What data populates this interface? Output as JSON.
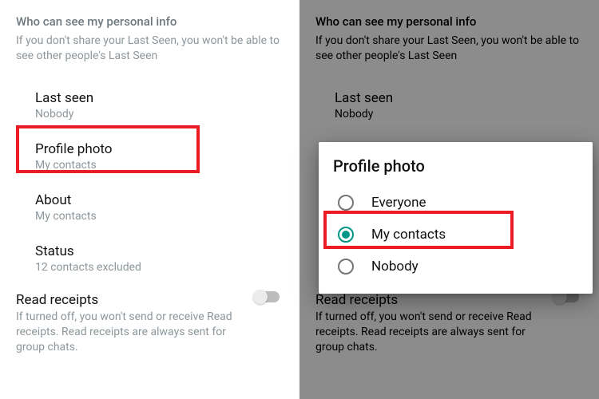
{
  "section": {
    "title": "Who can see my personal info",
    "subtitle": "If you don't share your Last Seen, you won't be able to see other people's Last Seen"
  },
  "rows": {
    "last_seen": {
      "title": "Last seen",
      "value": "Nobody"
    },
    "profile_photo": {
      "title": "Profile photo",
      "value": "My contacts"
    },
    "about": {
      "title": "About",
      "value": "My contacts"
    },
    "status": {
      "title": "Status",
      "value": "12 contacts excluded"
    }
  },
  "read_receipts": {
    "title": "Read receipts",
    "subtitle": "If turned off, you won't send or receive Read receipts. Read receipts are always sent for group chats.",
    "enabled": false
  },
  "modal": {
    "title": "Profile photo",
    "options": [
      "Everyone",
      "My contacts",
      "Nobody"
    ],
    "selected": "My contacts"
  }
}
